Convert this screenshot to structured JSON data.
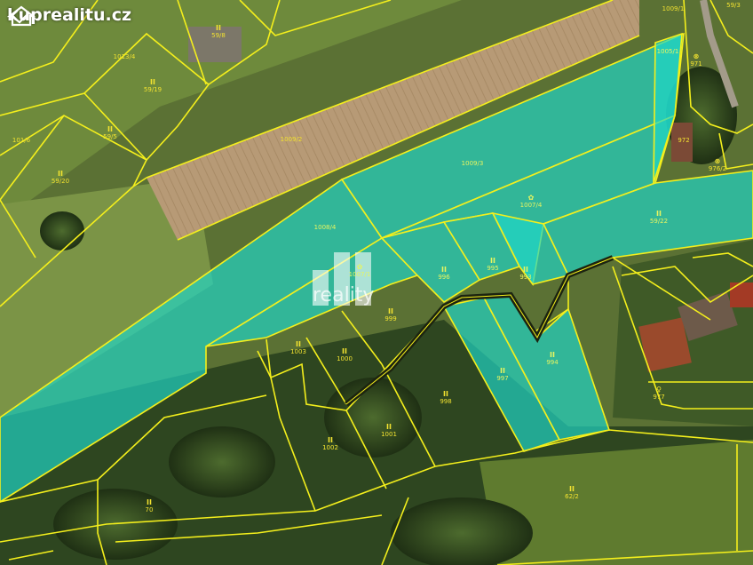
{
  "site": {
    "logo_text": "kuprealitu.cz",
    "watermark_text": "reality"
  },
  "colors": {
    "parcel_border": "#f4ef1c",
    "highlight_fill": "#1fd7c8",
    "label_color": "#f2e230"
  },
  "parcel_labels": [
    {
      "id": "p-59-8",
      "sym": "II",
      "num": "59/8"
    },
    {
      "id": "p-1013-4",
      "sym": "",
      "num": "1013/4"
    },
    {
      "id": "p-59-19",
      "sym": "II",
      "num": "59/19"
    },
    {
      "id": "p-59-5",
      "sym": "II",
      "num": "59/5"
    },
    {
      "id": "p-101-6",
      "sym": "",
      "num": "101/6"
    },
    {
      "id": "p-59-20",
      "sym": "II",
      "num": "59/20"
    },
    {
      "id": "p-1009-2",
      "sym": "",
      "num": "1009/2"
    },
    {
      "id": "p-1009-1",
      "sym": "",
      "num": "1009/1"
    },
    {
      "id": "p-1009-3",
      "sym": "",
      "num": "1009/3"
    },
    {
      "id": "p-1008-4",
      "sym": "",
      "num": "1008/4"
    },
    {
      "id": "p-1007-4",
      "sym": "✿",
      "num": "1007/4"
    },
    {
      "id": "p-59-22",
      "sym": "II",
      "num": "59/22"
    },
    {
      "id": "p-1007-1",
      "sym": "✿",
      "num": "1007/1"
    },
    {
      "id": "p-996",
      "sym": "II",
      "num": "996"
    },
    {
      "id": "p-995",
      "sym": "II",
      "num": "995"
    },
    {
      "id": "p-993",
      "sym": "II",
      "num": "993"
    },
    {
      "id": "p-999",
      "sym": "II",
      "num": "999"
    },
    {
      "id": "p-1003",
      "sym": "II",
      "num": "1003"
    },
    {
      "id": "p-1000",
      "sym": "II",
      "num": "1000"
    },
    {
      "id": "p-998",
      "sym": "II",
      "num": "998"
    },
    {
      "id": "p-994",
      "sym": "II",
      "num": "994"
    },
    {
      "id": "p-997",
      "sym": "II",
      "num": "997"
    },
    {
      "id": "p-1001",
      "sym": "II",
      "num": "1001"
    },
    {
      "id": "p-1002",
      "sym": "II",
      "num": "1002"
    },
    {
      "id": "p-70",
      "sym": "II",
      "num": "70"
    },
    {
      "id": "p-62-2",
      "sym": "II",
      "num": "62/2"
    },
    {
      "id": "p-971",
      "sym": "⊗",
      "num": "971"
    },
    {
      "id": "p-976-2",
      "sym": "⊗",
      "num": "976/2"
    },
    {
      "id": "p-977",
      "sym": "♀",
      "num": "977"
    },
    {
      "id": "p-1005",
      "sym": "",
      "num": "1005/1"
    },
    {
      "id": "p-59-3",
      "sym": "",
      "num": "59/3"
    },
    {
      "id": "p-972",
      "sym": "",
      "num": "972"
    }
  ]
}
